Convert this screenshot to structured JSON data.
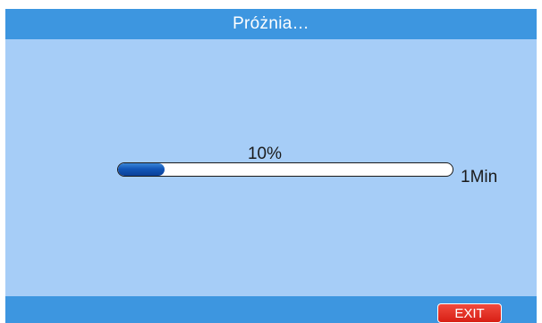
{
  "header": {
    "title": "Próżnia…"
  },
  "progress": {
    "percent_label": "10%",
    "fraction": 0.1,
    "time_label": "1Min"
  },
  "footer": {
    "exit_label": "EXIT"
  },
  "colors": {
    "bar_blue": "#3d96e0",
    "background": "#a6cdf7",
    "fill_blue": "#1256b8",
    "exit_red": "#d81f14"
  }
}
